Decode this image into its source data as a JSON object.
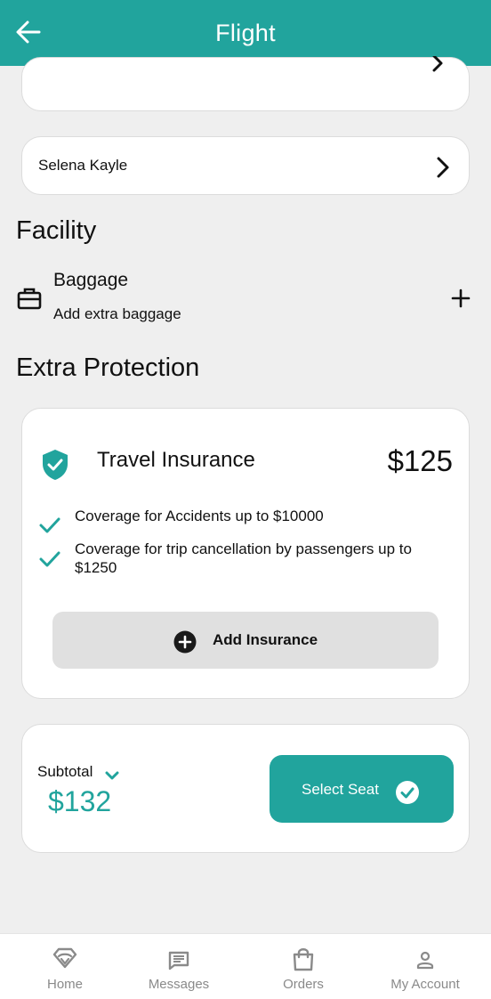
{
  "header": {
    "title": "Flight"
  },
  "passenger": {
    "name": "Selena Kayle"
  },
  "facility": {
    "section_title": "Facility",
    "baggage": {
      "title": "Baggage",
      "subtitle": "Add extra baggage"
    }
  },
  "protection": {
    "section_title": "Extra Protection",
    "insurance": {
      "title": "Travel Insurance",
      "price": "$125",
      "coverage": [
        "Coverage for Accidents up to $10000",
        "Coverage for trip cancellation by passengers up to $1250"
      ],
      "button_label": "Add Insurance"
    }
  },
  "summary": {
    "subtotal_label": "Subtotal",
    "subtotal_amount": "$132",
    "button_label": "Select Seat"
  },
  "nav": {
    "items": [
      {
        "label": "Home",
        "icon": "home-icon"
      },
      {
        "label": "Messages",
        "icon": "messages-icon"
      },
      {
        "label": "Orders",
        "icon": "orders-bag-icon"
      },
      {
        "label": "My Account",
        "icon": "account-icon"
      }
    ]
  },
  "colors": {
    "accent": "#21a49d",
    "background": "#efefef",
    "button_gray": "#e0e0e0"
  }
}
